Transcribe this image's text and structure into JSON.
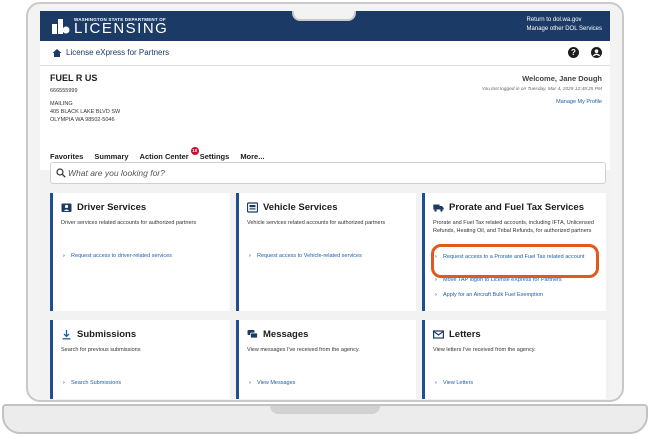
{
  "banner": {
    "logo_small": "WASHINGTON STATE DEPARTMENT OF",
    "logo_big": "LICENSING",
    "return_link": "Return to dol.wa.gov",
    "manage_services_link": "Manage other DOL Services"
  },
  "app_bar": {
    "title": "License eXpress for Partners",
    "help_icon": "question-circle-icon",
    "user_icon": "account-circle-icon"
  },
  "account": {
    "name": "FUEL R US",
    "id": "666555999",
    "address_lines": [
      "MAILING",
      "405 BLACK LAKE BLVD SW",
      "OLYMPIA WA 98502-5046"
    ],
    "welcome": "Welcome, Jane Dough",
    "last_login": "You last logged in on Tuesday, Mar 4, 2025 12:49:25 PM",
    "manage_profile": "Manage My Profile"
  },
  "tabs": [
    {
      "label": "Favorites"
    },
    {
      "label": "Summary"
    },
    {
      "label": "Action Center",
      "badge": "10"
    },
    {
      "label": "Settings"
    },
    {
      "label": "More..."
    }
  ],
  "search": {
    "placeholder": "What are you looking for?"
  },
  "cards": {
    "driver": {
      "title": "Driver Services",
      "desc": "Driver services related accounts for authorized partners",
      "links": [
        "Request access to driver-related services"
      ]
    },
    "vehicle": {
      "title": "Vehicle Services",
      "desc": "Vehicle services related accounts for authorized partners",
      "links": [
        "Request access to Vehicle-related services"
      ]
    },
    "prorate": {
      "title": "Prorate and Fuel Tax Services",
      "desc": "Prorate and Fuel Tax related accounts, including IFTA, Unlicensed Refunds, Heating Oil, and Tribal Refunds, for authorized partners",
      "links": [
        "Request access to a Prorate and Fuel Tax related account",
        "Move TAP logon to License eXpress for Partners",
        "Apply for an Aircraft Bulk Fuel Exemption"
      ]
    },
    "submissions": {
      "title": "Submissions",
      "desc": "Search for previous submissions",
      "links": [
        "Search Submissions"
      ]
    },
    "messages": {
      "title": "Messages",
      "desc": "View messages I've received from the agency.",
      "links": [
        "View Messages"
      ]
    },
    "letters": {
      "title": "Letters",
      "desc": "View letters I've received from the agency.",
      "links": [
        "View Letters"
      ]
    }
  },
  "colors": {
    "brand_navy": "#1b3a66",
    "link_blue": "#1f5fa8",
    "highlight_orange": "#e05a1e",
    "badge_red": "#c8102e"
  }
}
